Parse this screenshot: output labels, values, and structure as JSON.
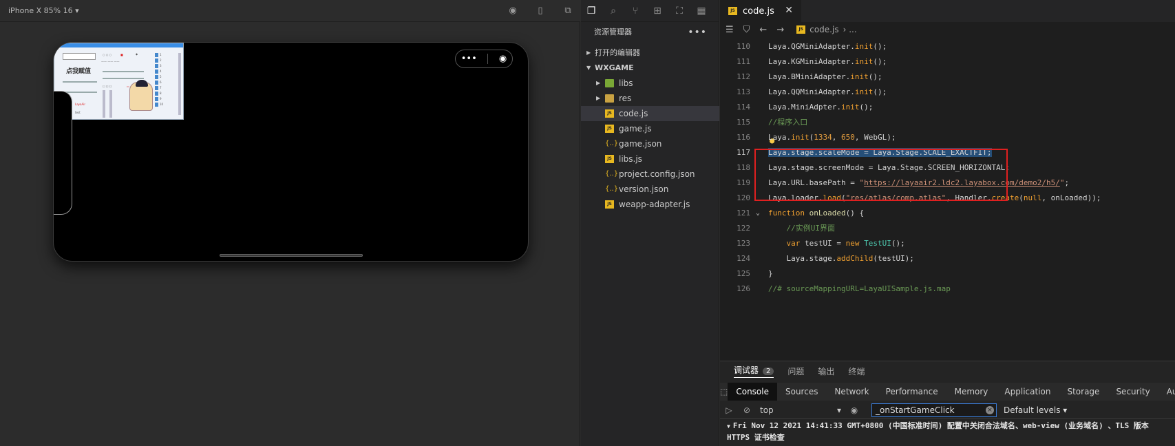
{
  "simulator": {
    "device_label": "iPhone X 85% 16 ▾",
    "icons": [
      "record-icon",
      "phone-icon",
      "window-icon"
    ],
    "mini_ui": {
      "button_text": "",
      "big_label": "点我赋值",
      "red_text": "LayaAir",
      "small_text": "test"
    }
  },
  "activity_icons": [
    "files-icon",
    "search-icon",
    "source-control-icon",
    "extensions-icon",
    "debug-icon",
    "docker-icon"
  ],
  "explorer": {
    "title": "资源管理器",
    "more": "•••",
    "open_editors": "打开的编辑器",
    "workspace": "WXGAME",
    "items": [
      {
        "label": "libs",
        "type": "folder-libs"
      },
      {
        "label": "res",
        "type": "folder"
      },
      {
        "label": "code.js",
        "type": "js"
      },
      {
        "label": "game.js",
        "type": "js"
      },
      {
        "label": "game.json",
        "type": "json"
      },
      {
        "label": "libs.js",
        "type": "js"
      },
      {
        "label": "project.config.json",
        "type": "json"
      },
      {
        "label": "version.json",
        "type": "json"
      },
      {
        "label": "weapp-adapter.js",
        "type": "js"
      }
    ]
  },
  "editor": {
    "tab_label": "code.js",
    "tab_close": "✕",
    "breadcrumb_file": "code.js",
    "breadcrumb_rest": "› ...",
    "lines": [
      {
        "n": "110"
      },
      {
        "n": "111"
      },
      {
        "n": "112"
      },
      {
        "n": "113"
      },
      {
        "n": "114"
      },
      {
        "n": "115"
      },
      {
        "n": "116"
      },
      {
        "n": "117"
      },
      {
        "n": "118"
      },
      {
        "n": "119"
      },
      {
        "n": "120"
      },
      {
        "n": "121"
      },
      {
        "n": "122"
      },
      {
        "n": "123"
      },
      {
        "n": "124"
      },
      {
        "n": "125"
      },
      {
        "n": "126"
      }
    ]
  },
  "devtools": {
    "tabs": [
      "调试器",
      "问题",
      "输出",
      "终端"
    ],
    "debugger_badge": "2",
    "panel_tabs": [
      "Console",
      "Sources",
      "Network",
      "Performance",
      "Memory",
      "Application",
      "Storage",
      "Security",
      "Audi"
    ],
    "context": "top",
    "filter_value": "_onStartGameClick",
    "levels": "Default levels ▾",
    "log_line1": "Fri Nov 12 2021 14:41:33 GMT+0800 (中国标准时间) 配置中关闭合法域名、web-view (业务域名) 、TLS 版本",
    "log_line2": "HTTPS 证书检查"
  }
}
